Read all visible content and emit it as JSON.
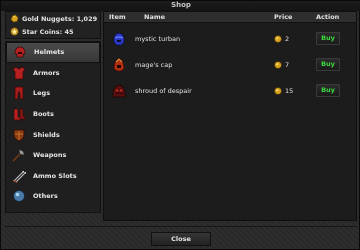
{
  "window": {
    "title": "Shop"
  },
  "currency": {
    "gold": {
      "label": "Gold Nuggets: 1,029",
      "icon": "gold-nugget-icon"
    },
    "stars": {
      "label": "Star Coins: 45",
      "icon": "star-coin-icon"
    }
  },
  "categories": [
    {
      "label": "Helmets",
      "icon": "helmet-icon",
      "selected": true
    },
    {
      "label": "Armors",
      "icon": "armor-icon",
      "selected": false
    },
    {
      "label": "Legs",
      "icon": "legs-icon",
      "selected": false
    },
    {
      "label": "Boots",
      "icon": "boots-icon",
      "selected": false
    },
    {
      "label": "Shields",
      "icon": "shield-icon",
      "selected": false
    },
    {
      "label": "Weapons",
      "icon": "weapon-icon",
      "selected": false
    },
    {
      "label": "Ammo Slots",
      "icon": "ammo-icon",
      "selected": false
    },
    {
      "label": "Others",
      "icon": "others-icon",
      "selected": false
    }
  ],
  "table": {
    "headers": {
      "item": "Item",
      "name": "Name",
      "price": "Price",
      "action": "Action"
    },
    "rows": [
      {
        "name": "mystic turban",
        "price": "2",
        "buy_label": "Buy",
        "icon": "turban-icon"
      },
      {
        "name": "mage's cap",
        "price": "7",
        "buy_label": "Buy",
        "icon": "cap-icon"
      },
      {
        "name": "shroud of despair",
        "price": "15",
        "buy_label": "Buy",
        "icon": "shroud-icon"
      }
    ]
  },
  "footer": {
    "close_label": "Close"
  },
  "colors": {
    "buy_text": "#3ddc3d",
    "coin": "#d9a520"
  }
}
